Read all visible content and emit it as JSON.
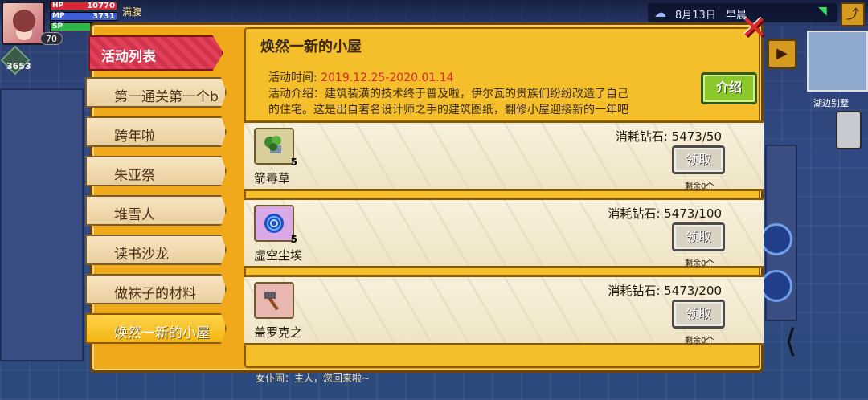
{
  "player": {
    "hp": "10770",
    "mp": "3731",
    "sp_label": "SP",
    "hp_label": "HP",
    "mp_label": "MP",
    "level": "70",
    "coins": "3653",
    "top_label": "满腹"
  },
  "status": {
    "date": "8月13日",
    "period": "早晨"
  },
  "minimap": {
    "label": "湖边别墅"
  },
  "panel": {
    "tab_header": "活动列表",
    "list": [
      "第一通关第一个b",
      "跨年啦",
      "朱亚祭",
      "堆雪人",
      "读书沙龙",
      "做袜子的材料",
      "焕然一新的小屋"
    ],
    "active_index": 6
  },
  "event": {
    "title": "焕然一新的小屋",
    "time_label": "活动时间:",
    "time_value": "2019.12.25-2020.01.14",
    "intro_line1": "活动介绍：建筑装潢的技术终于普及啦，伊尔瓦的贵族们纷纷改造了自己",
    "intro_line2": "的住宅。这是出自著名设计师之手的建筑图纸，翻修小屋迎接新的一年吧",
    "intro_button": "介绍"
  },
  "rewards": [
    {
      "name": "箭毒草",
      "count": "5",
      "cost": "消耗钻石: 5473/50",
      "button": "领取",
      "remain": "剩余0个",
      "icon": "herb-icon"
    },
    {
      "name": "虚空尘埃",
      "count": "5",
      "cost": "消耗钻石: 5473/100",
      "button": "领取",
      "remain": "剩余0个",
      "icon": "void-dust-icon"
    },
    {
      "name": "盖罗克之",
      "count": "",
      "cost": "消耗钻石: 5473/200",
      "button": "领取",
      "remain": "剩余0个",
      "icon": "hammer-icon"
    }
  ],
  "chat": {
    "text": "女仆闹：主人，您回来啦~"
  },
  "colors": {
    "panel": "#f0a91a",
    "active_tab": "#e04058",
    "intro_button": "#8bc82c",
    "date_red": "#d8261d"
  }
}
